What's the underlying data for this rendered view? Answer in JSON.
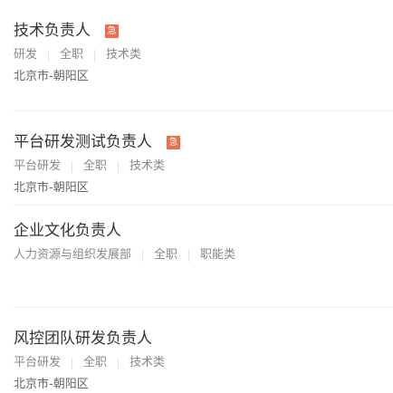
{
  "accent_color": "#f26b4a",
  "urgent_badge": "急",
  "jobs": [
    {
      "title": "技术负责人",
      "urgent": true,
      "tags": [
        "研发",
        "全职",
        "技术类"
      ],
      "location": "北京市-朝阳区"
    },
    {
      "title": "平台研发测试负责人",
      "urgent": true,
      "tags": [
        "平台研发",
        "全职",
        "技术类"
      ],
      "location": "北京市-朝阳区"
    },
    {
      "title": "企业文化负责人",
      "urgent": false,
      "tags": [
        "人力资源与组织发展部",
        "全职",
        "职能类"
      ],
      "location": ""
    },
    {
      "title": "风控团队研发负责人",
      "urgent": false,
      "tags": [
        "平台研发",
        "全职",
        "技术类"
      ],
      "location": "北京市-朝阳区"
    }
  ]
}
